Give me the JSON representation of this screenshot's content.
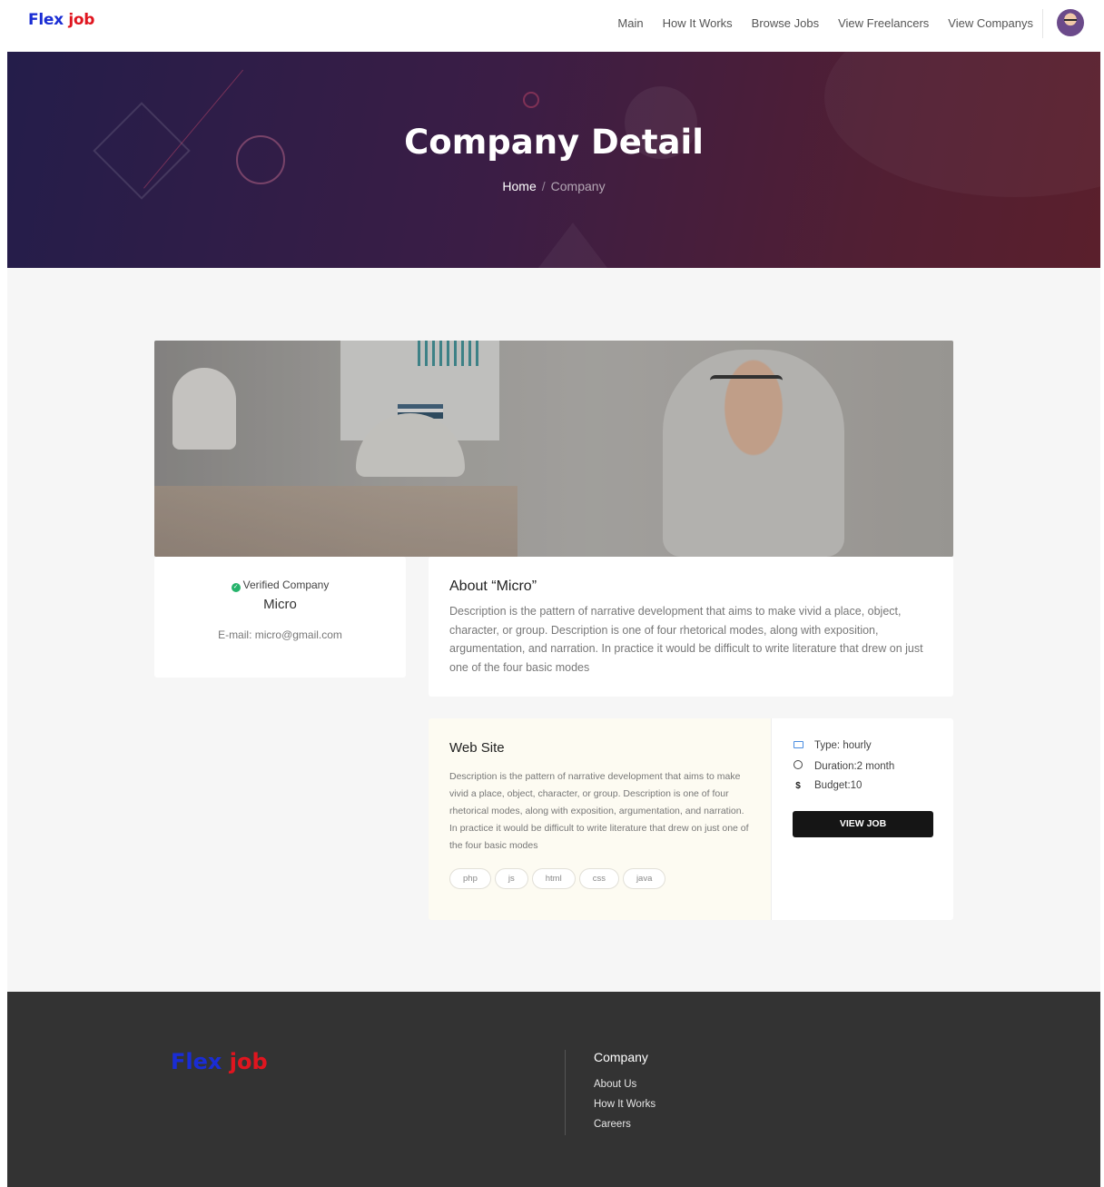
{
  "header": {
    "logo": {
      "part1": "Flex",
      "part2": "job"
    },
    "nav": [
      "Main",
      "How It Works",
      "Browse Jobs",
      "View Freelancers",
      "View Companys"
    ]
  },
  "hero": {
    "title": "Company Detail",
    "breadcrumb": {
      "home": "Home",
      "separator": "/",
      "current": "Company"
    }
  },
  "company": {
    "verified_label": "Verified Company",
    "name": "Micro",
    "email": "E-mail: micro@gmail.com"
  },
  "about": {
    "title": "About “Micro”",
    "description": "Description is the pattern of narrative development that aims to make vivid a place, object, character, or group. Description is one of four rhetorical modes, along with exposition, argumentation, and narration. In practice it would be difficult to write literature that drew on just one of the four basic modes"
  },
  "job": {
    "title": "Web Site",
    "description": "Description is the pattern of narrative development that aims to make vivid a place, object, character, or group. Description is one of four rhetorical modes, along with exposition, argumentation, and narration. In practice it would be difficult to write literature that drew on just one of the four basic modes",
    "tags": [
      "php",
      "js",
      "html",
      "css",
      "java"
    ],
    "type": "Type: hourly",
    "duration": "Duration:2 month",
    "budget": "Budget:10",
    "budget_icon": "$",
    "view_button": "VIEW JOB"
  },
  "footer": {
    "logo": {
      "part1": "Flex",
      "part2": "job"
    },
    "column_title": "Company",
    "links": [
      "About Us",
      "How It Works",
      "Careers"
    ]
  },
  "colors": {
    "logo_blue": "#1a2dd4",
    "logo_red": "#e0151f",
    "verified_green": "#25b36b",
    "footer_bg": "#333333"
  }
}
